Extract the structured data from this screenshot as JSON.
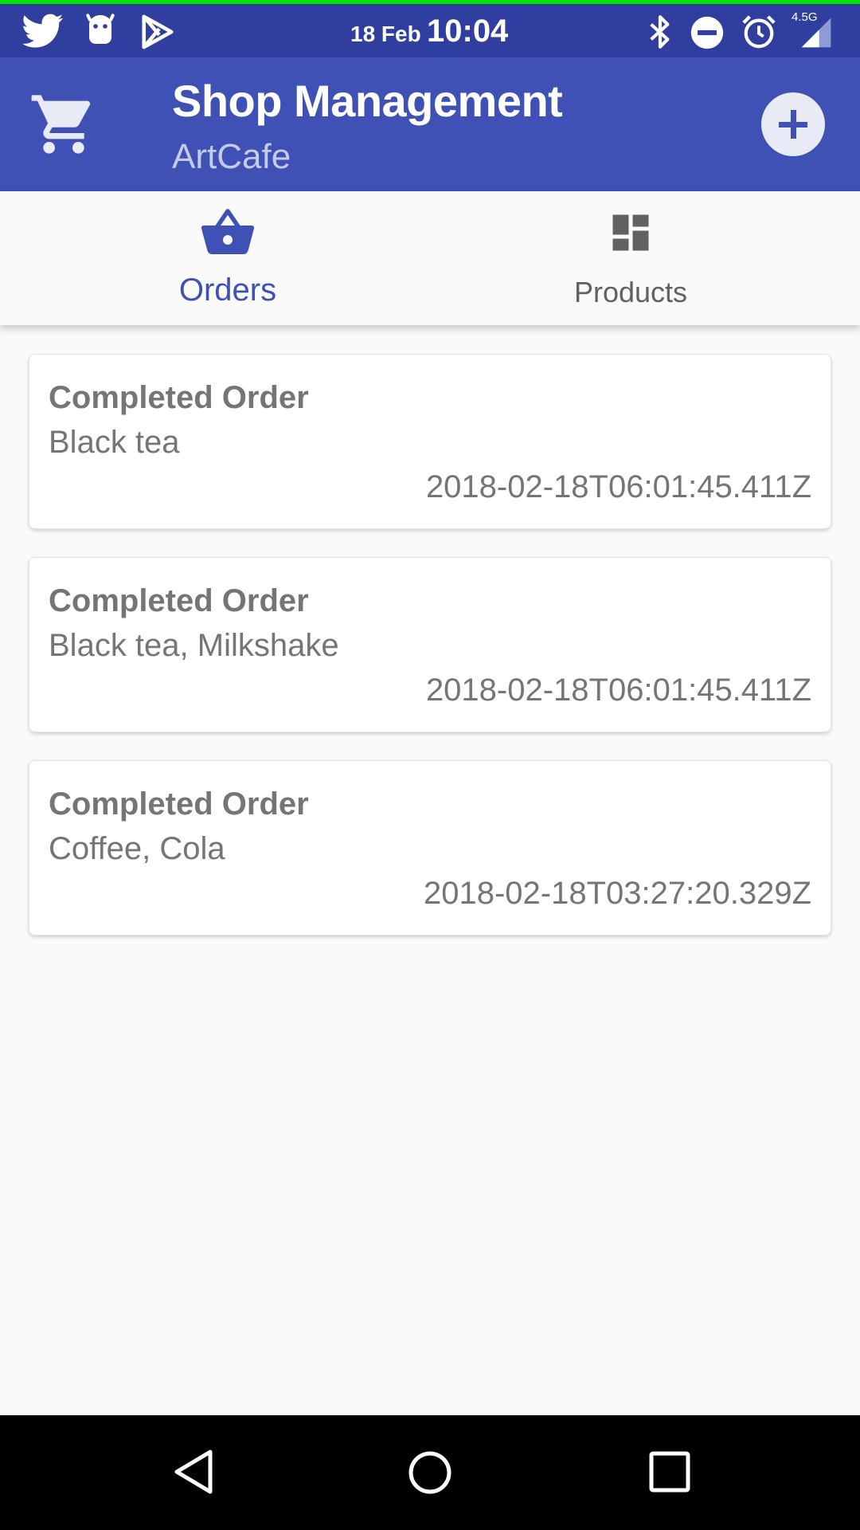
{
  "status_bar": {
    "date": "18 Feb",
    "time": "10:04",
    "network": "4.5G",
    "icons": [
      "twitter-icon",
      "android-icon",
      "play-store-icon",
      "bluetooth-icon",
      "do-not-disturb-icon",
      "alarm-icon",
      "signal-icon"
    ]
  },
  "app_bar": {
    "title": "Shop Management",
    "subtitle": "ArtCafe",
    "icons": [
      "cart-icon",
      "add-icon"
    ]
  },
  "tabs": [
    {
      "label": "Orders",
      "icon": "basket-icon",
      "selected": true
    },
    {
      "label": "Products",
      "icon": "dashboard-icon",
      "selected": false
    }
  ],
  "orders": [
    {
      "title": "Completed Order",
      "items": "Black tea",
      "timestamp": "2018-02-18T06:01:45.411Z"
    },
    {
      "title": "Completed Order",
      "items": "Black tea, Milkshake",
      "timestamp": "2018-02-18T06:01:45.411Z"
    },
    {
      "title": "Completed Order",
      "items": "Coffee, Cola",
      "timestamp": "2018-02-18T03:27:20.329Z"
    }
  ],
  "nav_bar": {
    "icons": [
      "back-icon",
      "home-icon",
      "recents-icon"
    ]
  },
  "colors": {
    "primary": "#3f51b5",
    "primary_dark": "#303f9f",
    "text_secondary": "#757575"
  }
}
